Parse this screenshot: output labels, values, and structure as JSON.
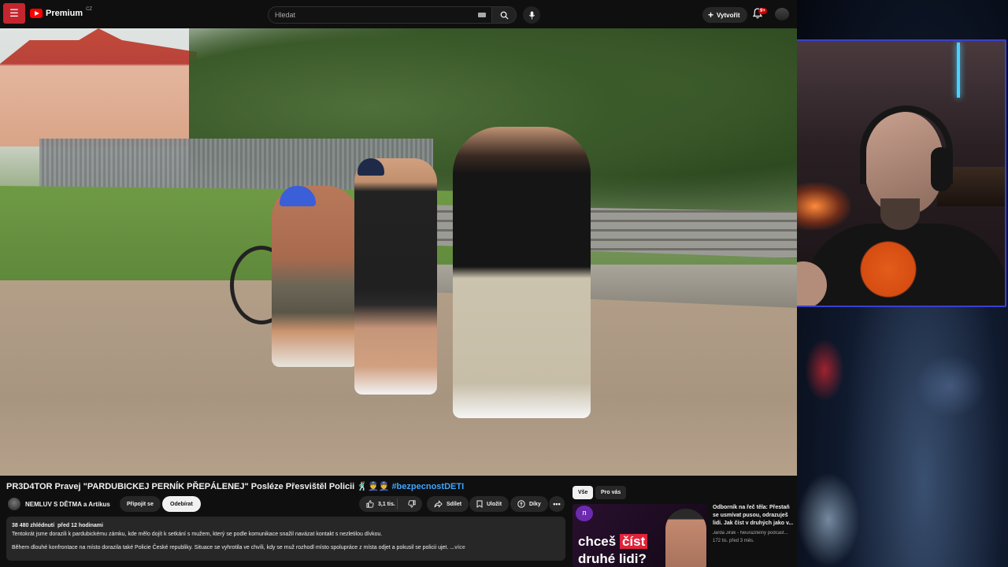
{
  "topbar": {
    "logo_text": "Premium",
    "region": "CZ",
    "search_placeholder": "Hledat",
    "create_label": "Vytvořit",
    "notification_count": "9+"
  },
  "video": {
    "title": "PR3D4TOR Pravej \"PARDUBICKEJ PERNÍK PŘEPÁLENEJ\" Posléze Přesvištěl Policii 🕺👮👮",
    "hashtag": "#bezpecnostDETI",
    "channel": "NEMLUV S DĚTMA a Artikus",
    "join_label": "Připojit se",
    "subscribe_label": "Odebírat",
    "likes": "3,1 tis.",
    "share_label": "Sdílet",
    "save_label": "Uložit",
    "thanks_label": "Díky",
    "more_label": "•••"
  },
  "description": {
    "views": "38 480 zhlédnutí",
    "age": "před 12 hodinami",
    "line1": "Tentokrát jsme dorazili k pardubickému zámku, kde mělo dojít k setkání s mužem, který se podle komunikace snažil navázat kontakt s nezletilou dívkou.",
    "line2": "Během dlouhé konfrontace na místo dorazila také Policie České republiky. Situace se vyhrotila ve chvíli, kdy se muž rozhodl místo spolupráce z místa odjet a pokusil se policii ujet.",
    "more": "...více"
  },
  "recommendations": {
    "chip_all": "Vše",
    "chip_foryou": "Pro vás",
    "item": {
      "thumb_line1_a": "chceš",
      "thumb_line1_b": "číst",
      "thumb_line2": "druhé lidi?",
      "title": "Odborník na řeč těla: Přestaň se usmívat pusou, odrazuješ lidi. Jak číst v druhých jako v...",
      "channel": "Jarda Jirák - Neurazitelný podcast...",
      "meta": "172 tis.  před 3 měs."
    }
  },
  "colors": {
    "background": "#0f0f0f",
    "accent_red": "#ff0000",
    "link_blue": "#3ea6ff",
    "webcam_border": "#3a3fd0"
  }
}
